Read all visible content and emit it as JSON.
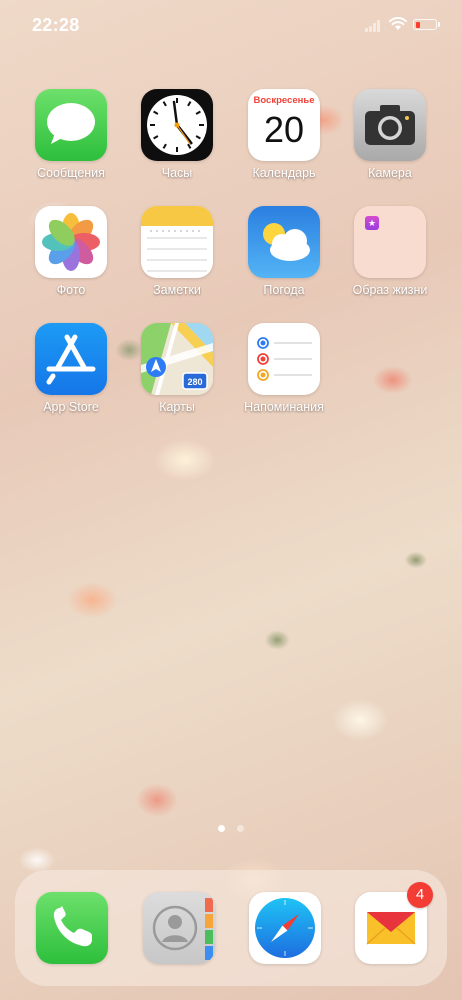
{
  "status_bar": {
    "time": "22:28",
    "battery_color": "#ff3b30"
  },
  "apps": {
    "messages": {
      "label": "Сообщения",
      "icon": "speech-bubble-icon"
    },
    "clock": {
      "label": "Часы",
      "icon": "clock-face-icon"
    },
    "calendar": {
      "label": "Календарь",
      "day_name": "Воскресенье",
      "date": "20"
    },
    "camera": {
      "label": "Камера",
      "icon": "camera-icon"
    },
    "photos": {
      "label": "Фото",
      "icon": "photos-flower-icon"
    },
    "notes": {
      "label": "Заметки",
      "icon": "notepad-icon"
    },
    "weather": {
      "label": "Погода",
      "icon": "sun-cloud-icon"
    },
    "lifestyle": {
      "label": "Образ жизни",
      "icon": "folder-icon",
      "badge_char": "★"
    },
    "appstore": {
      "label": "App Store",
      "icon": "app-store-icon"
    },
    "maps": {
      "label": "Карты",
      "icon": "map-icon",
      "highway_number": "280"
    },
    "reminders": {
      "label": "Напоминания",
      "icon": "reminders-list-icon"
    }
  },
  "page_indicator": {
    "pages": 2,
    "active_index": 0
  },
  "dock": {
    "phone": {
      "icon": "phone-handset-icon"
    },
    "contacts": {
      "icon": "contacts-icon"
    },
    "safari": {
      "icon": "compass-icon"
    },
    "mail": {
      "icon": "envelope-icon",
      "badge": "4"
    }
  },
  "colors": {
    "badge_red": "#f23c34",
    "messages_green": "#2dbf3c",
    "appstore_blue": "#1576e8"
  }
}
